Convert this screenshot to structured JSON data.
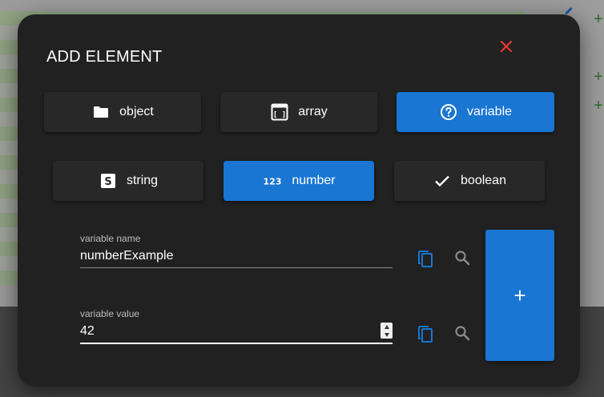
{
  "dialog": {
    "title": "ADD ELEMENT",
    "close_icon": "close-icon"
  },
  "container_types": [
    {
      "label": "object",
      "icon": "folder-icon",
      "selected": false
    },
    {
      "label": "array",
      "icon": "array-icon",
      "selected": false
    },
    {
      "label": "variable",
      "icon": "help-circle-icon",
      "selected": true
    }
  ],
  "value_types": [
    {
      "label": "string",
      "icon": "string-icon",
      "selected": false
    },
    {
      "label": "number",
      "icon": "number-icon",
      "selected": true,
      "icon_text": "123"
    },
    {
      "label": "boolean",
      "icon": "check-icon",
      "selected": false
    }
  ],
  "string_icon_text": "S",
  "array_icon_text": "[ ]",
  "fields": {
    "name": {
      "label": "variable name",
      "value": "numberExample"
    },
    "value": {
      "label": "variable value",
      "value": "42"
    }
  },
  "add_button_label": "+",
  "colors": {
    "accent": "#1976d2",
    "dialog_bg": "#212121",
    "close": "#e53935",
    "copy_icon": "#1976d2",
    "search_icon": "#8a8a8a"
  },
  "background": {
    "plus_label": "+"
  }
}
